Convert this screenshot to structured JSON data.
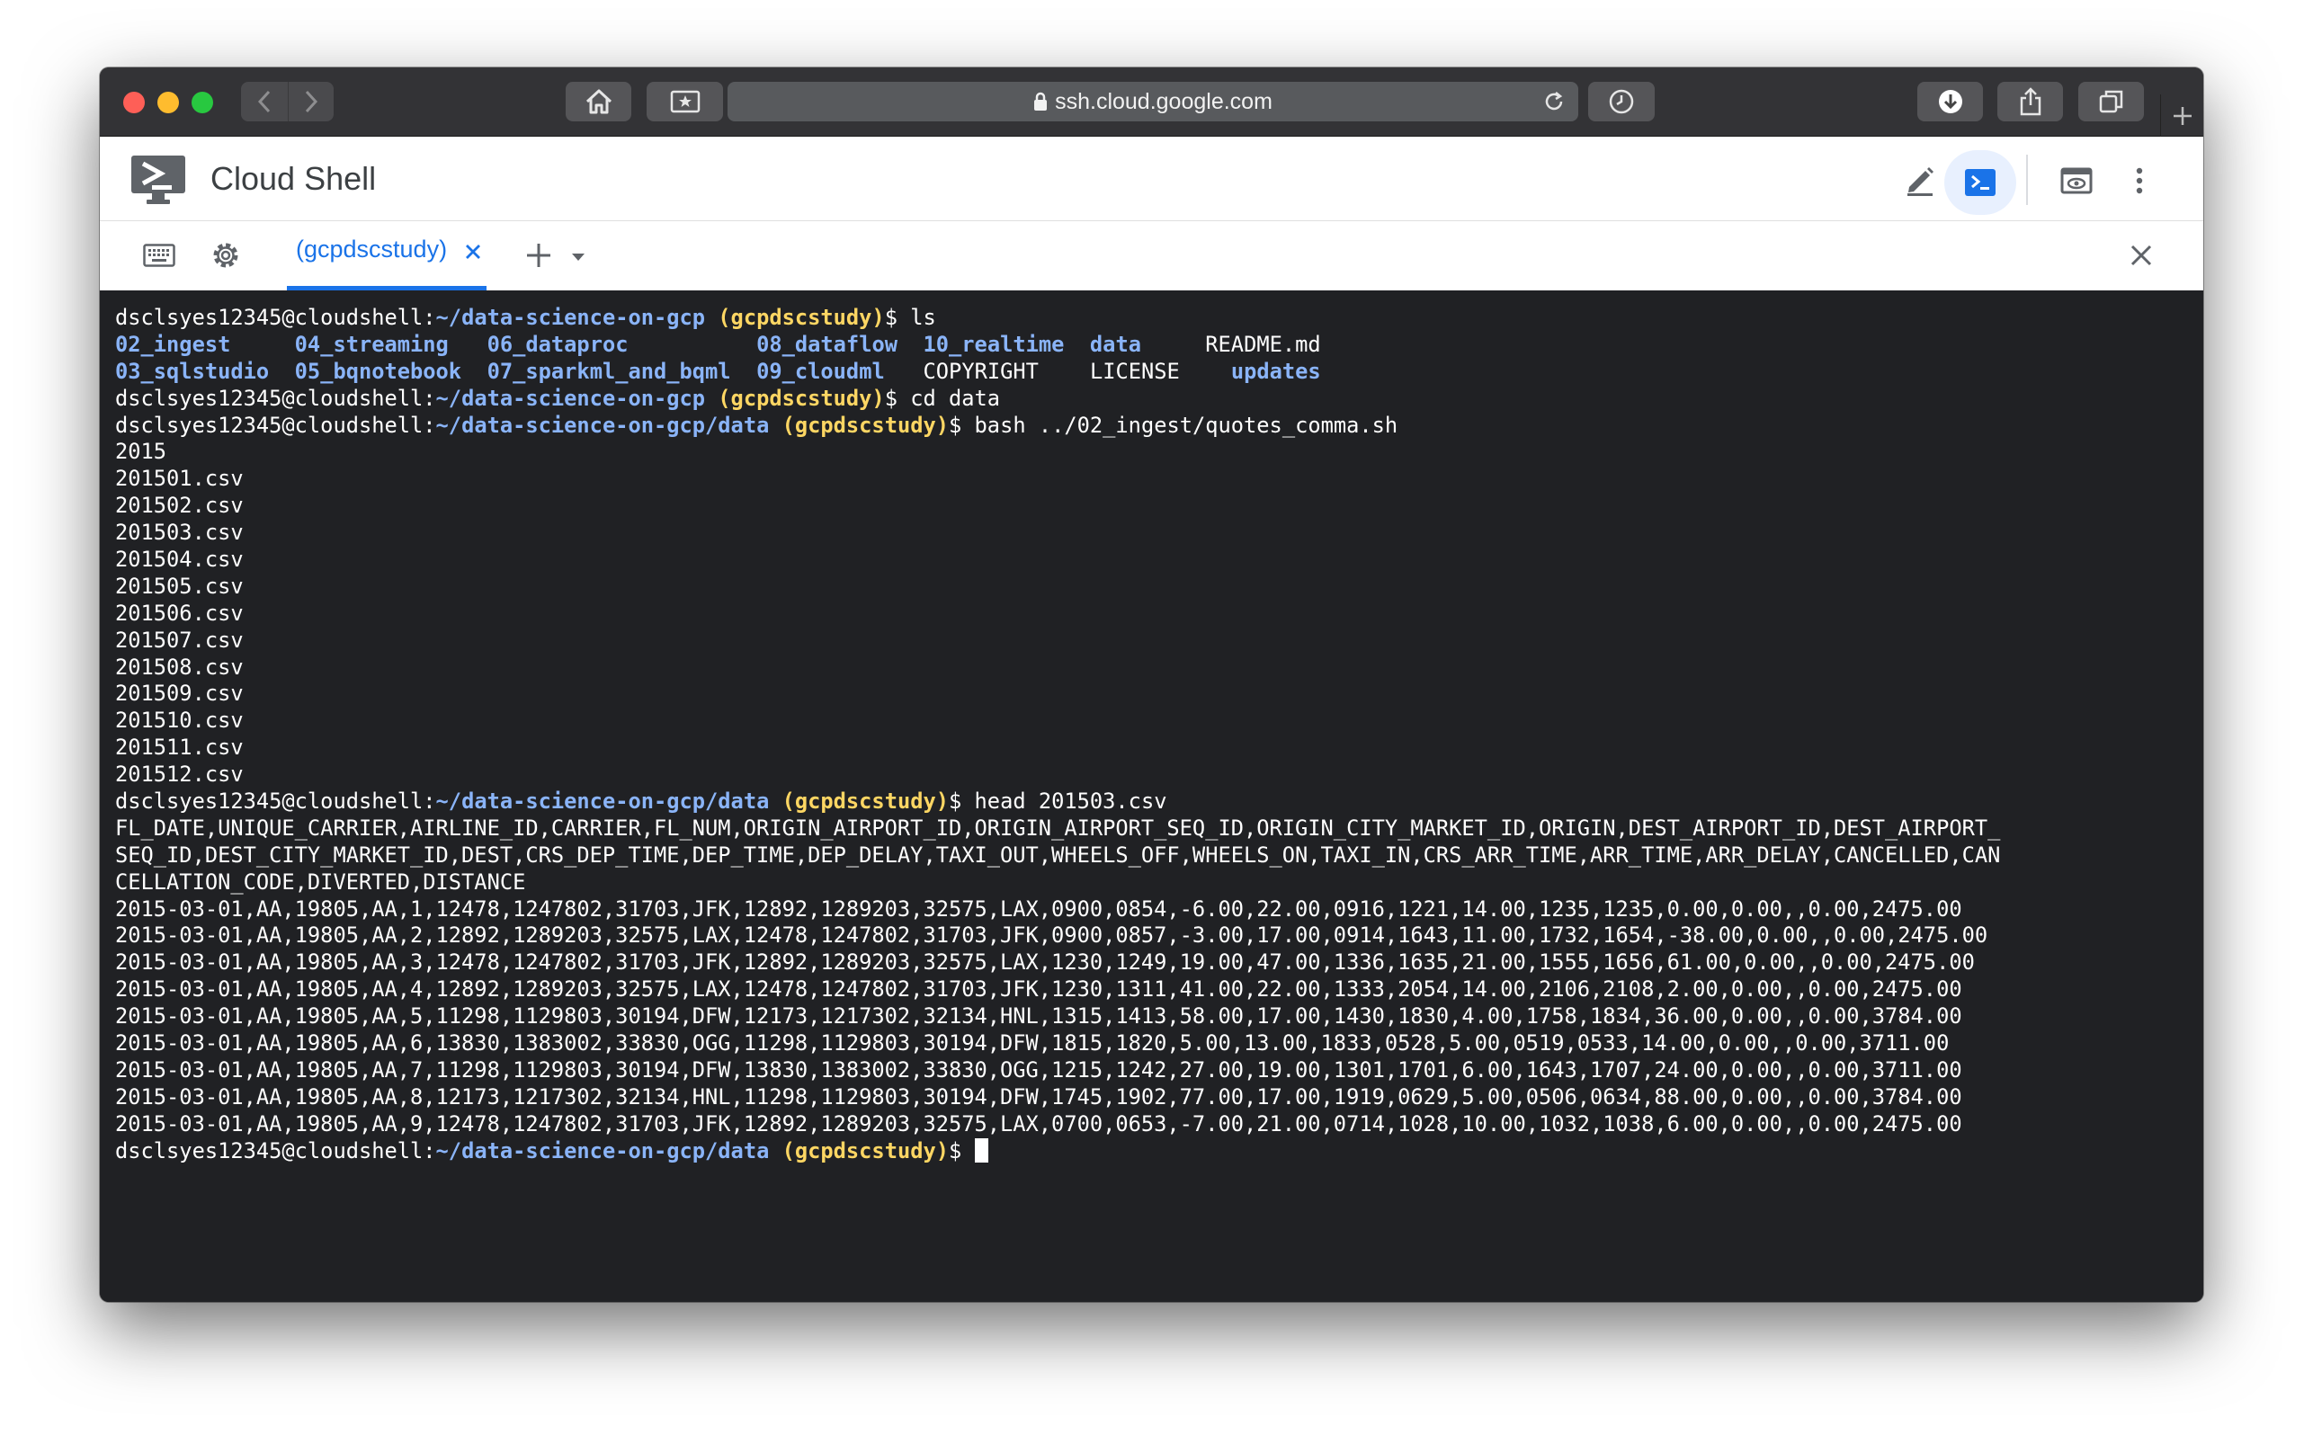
{
  "browser": {
    "url": "ssh.cloud.google.com"
  },
  "app": {
    "title": "Cloud Shell",
    "tab_label": "(gcpdscstudy)"
  },
  "terminal": {
    "prompt_user": "dsclsyes12345@cloudshell",
    "prompt_sep": ":",
    "project": "(gcpdscstudy)",
    "path_root": "~/data-science-on-gcp",
    "path_data": "~/data-science-on-gcp/data",
    "cmd_ls": "ls",
    "ls_row1": [
      {
        "text": "02_ingest",
        "dir": true
      },
      {
        "text": "04_streaming",
        "dir": true
      },
      {
        "text": "06_dataproc",
        "dir": true
      },
      {
        "text": "08_dataflow",
        "dir": true
      },
      {
        "text": "10_realtime",
        "dir": true
      },
      {
        "text": "data",
        "dir": true
      },
      {
        "text": "README.md",
        "dir": false
      }
    ],
    "ls_row2": [
      {
        "text": "03_sqlstudio",
        "dir": true
      },
      {
        "text": "05_bqnotebook",
        "dir": true
      },
      {
        "text": "07_sparkml_and_bqml",
        "dir": true
      },
      {
        "text": "09_cloudml",
        "dir": true
      },
      {
        "text": "COPYRIGHT",
        "dir": false
      },
      {
        "text": "LICENSE",
        "dir": false
      },
      {
        "text": "updates",
        "dir": true
      }
    ],
    "cmd_cd": "cd data",
    "cmd_bash": "bash ../02_ingest/quotes_comma.sh",
    "bash_output": [
      "2015",
      "201501.csv",
      "201502.csv",
      "201503.csv",
      "201504.csv",
      "201505.csv",
      "201506.csv",
      "201507.csv",
      "201508.csv",
      "201509.csv",
      "201510.csv",
      "201511.csv",
      "201512.csv"
    ],
    "cmd_head": "head 201503.csv",
    "head_output": [
      "FL_DATE,UNIQUE_CARRIER,AIRLINE_ID,CARRIER,FL_NUM,ORIGIN_AIRPORT_ID,ORIGIN_AIRPORT_SEQ_ID,ORIGIN_CITY_MARKET_ID,ORIGIN,DEST_AIRPORT_ID,DEST_AIRPORT_",
      "SEQ_ID,DEST_CITY_MARKET_ID,DEST,CRS_DEP_TIME,DEP_TIME,DEP_DELAY,TAXI_OUT,WHEELS_OFF,WHEELS_ON,TAXI_IN,CRS_ARR_TIME,ARR_TIME,ARR_DELAY,CANCELLED,CAN",
      "CELLATION_CODE,DIVERTED,DISTANCE",
      "2015-03-01,AA,19805,AA,1,12478,1247802,31703,JFK,12892,1289203,32575,LAX,0900,0854,-6.00,22.00,0916,1221,14.00,1235,1235,0.00,0.00,,0.00,2475.00",
      "2015-03-01,AA,19805,AA,2,12892,1289203,32575,LAX,12478,1247802,31703,JFK,0900,0857,-3.00,17.00,0914,1643,11.00,1732,1654,-38.00,0.00,,0.00,2475.00",
      "2015-03-01,AA,19805,AA,3,12478,1247802,31703,JFK,12892,1289203,32575,LAX,1230,1249,19.00,47.00,1336,1635,21.00,1555,1656,61.00,0.00,,0.00,2475.00",
      "2015-03-01,AA,19805,AA,4,12892,1289203,32575,LAX,12478,1247802,31703,JFK,1230,1311,41.00,22.00,1333,2054,14.00,2106,2108,2.00,0.00,,0.00,2475.00",
      "2015-03-01,AA,19805,AA,5,11298,1129803,30194,DFW,12173,1217302,32134,HNL,1315,1413,58.00,17.00,1430,1830,4.00,1758,1834,36.00,0.00,,0.00,3784.00",
      "2015-03-01,AA,19805,AA,6,13830,1383002,33830,OGG,11298,1129803,30194,DFW,1815,1820,5.00,13.00,1833,0528,5.00,0519,0533,14.00,0.00,,0.00,3711.00",
      "2015-03-01,AA,19805,AA,7,11298,1129803,30194,DFW,13830,1383002,33830,OGG,1215,1242,27.00,19.00,1301,1701,6.00,1643,1707,24.00,0.00,,0.00,3711.00",
      "2015-03-01,AA,19805,AA,8,12173,1217302,32134,HNL,11298,1129803,30194,DFW,1745,1902,77.00,17.00,1919,0629,5.00,0506,0634,88.00,0.00,,0.00,3784.00",
      "2015-03-01,AA,19805,AA,9,12478,1247802,31703,JFK,12892,1289203,32575,LAX,0700,0653,-7.00,21.00,0714,1028,10.00,1032,1038,6.00,0.00,,0.00,2475.00"
    ]
  }
}
